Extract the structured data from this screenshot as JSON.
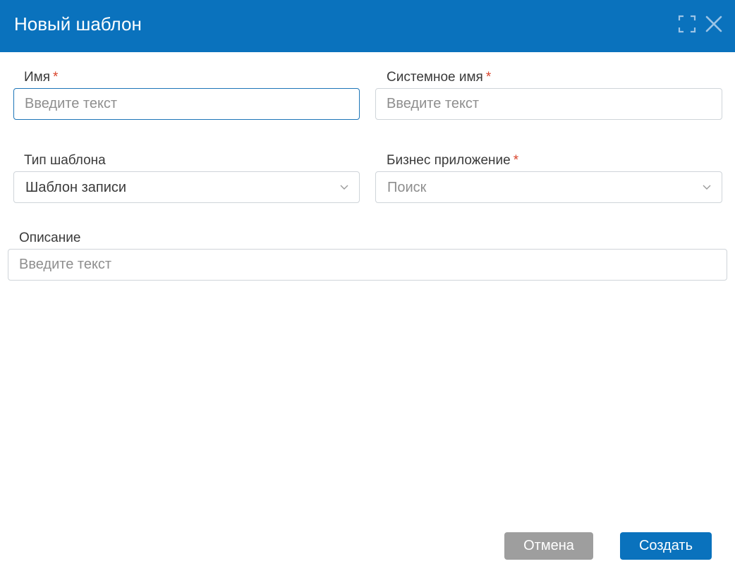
{
  "dialog": {
    "title": "Новый шаблон",
    "header_color": "#0a72bd",
    "icons": [
      "maximize-icon",
      "close-icon"
    ]
  },
  "fields": {
    "name": {
      "label": "Имя",
      "required_mark": "*",
      "placeholder": "Введите текст",
      "value": ""
    },
    "system_name": {
      "label": "Системное имя",
      "required_mark": "*",
      "placeholder": "Введите текст",
      "value": ""
    },
    "template_type": {
      "label": "Тип шаблона",
      "selected": "Шаблон записи"
    },
    "business_app": {
      "label": "Бизнес приложение",
      "required_mark": "*",
      "placeholder": "Поиск"
    },
    "description": {
      "label": "Описание",
      "placeholder": "Введите текст",
      "value": ""
    }
  },
  "footer": {
    "cancel_label": "Отмена",
    "create_label": "Создать",
    "cancel_color": "#9e9e9e",
    "create_color": "#0a72bd"
  },
  "colors": {
    "required": "#d9442b",
    "focus_border": "#1c75b8"
  }
}
